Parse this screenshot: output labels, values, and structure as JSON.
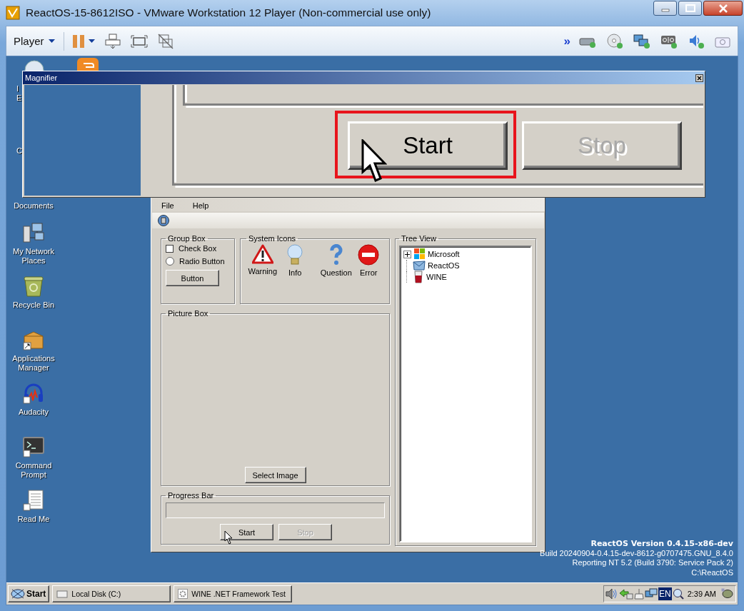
{
  "window": {
    "title": "ReactOS-15-8612ISO - VMware Workstation 12 Player (Non-commercial use only)"
  },
  "toolbar": {
    "player_menu": "Player",
    "more": "»"
  },
  "desktop": {
    "fragments": [
      "I",
      "E",
      "C"
    ],
    "icons": [
      {
        "label": "Documents",
        "kind": "documents"
      },
      {
        "label": "My Network Places",
        "kind": "network"
      },
      {
        "label": "Recycle Bin",
        "kind": "recycle"
      },
      {
        "label": "Applications Manager",
        "kind": "appmanager"
      },
      {
        "label": "Audacity",
        "kind": "audacity"
      },
      {
        "label": "Command Prompt",
        "kind": "cmd"
      },
      {
        "label": "Read Me",
        "kind": "readme"
      }
    ]
  },
  "magnifier": {
    "title": "Magnifier",
    "start": "Start",
    "stop": "Stop",
    "stop_disabled": true
  },
  "app": {
    "menu": [
      "File",
      "Help"
    ],
    "group_box": {
      "title": "Group Box",
      "checkbox": {
        "label": "Check Box",
        "checked": false
      },
      "radio": {
        "label": "Radio Button",
        "selected": false
      },
      "button": "Button"
    },
    "system_icons": {
      "title": "System Icons",
      "items": [
        {
          "label": "Warning",
          "kind": "warning"
        },
        {
          "label": "Info",
          "kind": "info"
        },
        {
          "label": "Question",
          "kind": "question"
        },
        {
          "label": "Error",
          "kind": "error"
        }
      ]
    },
    "picture_box": {
      "title": "Picture Box",
      "button": "Select Image"
    },
    "progress": {
      "title": "Progress Bar",
      "level": 0,
      "start": "Start",
      "stop": "Stop",
      "stop_disabled": true
    },
    "tree": {
      "title": "Tree View",
      "items": [
        {
          "label": "Microsoft",
          "kind": "microsoft",
          "expanded": false
        },
        {
          "label": "ReactOS",
          "kind": "reactos"
        },
        {
          "label": "WINE",
          "kind": "wine"
        }
      ]
    }
  },
  "version": {
    "title": "ReactOS Version 0.4.15-x86-dev",
    "details": [
      "Build 20240904-0.4.15-dev-8612-g0707475.GNU_8.4.0",
      "Reporting NT 5.2 (Build 3790: Service Pack 2)",
      "C:\\ReactOS"
    ]
  },
  "taskbar": {
    "start": "Start",
    "tasks": [
      {
        "label": "Local Disk (C:)",
        "kind": "drive",
        "selected": false
      },
      {
        "label": "WINE .NET Framework Test",
        "kind": "app",
        "selected": false
      }
    ],
    "tray": {
      "language": "EN",
      "clock": "2:39 AM"
    }
  }
}
